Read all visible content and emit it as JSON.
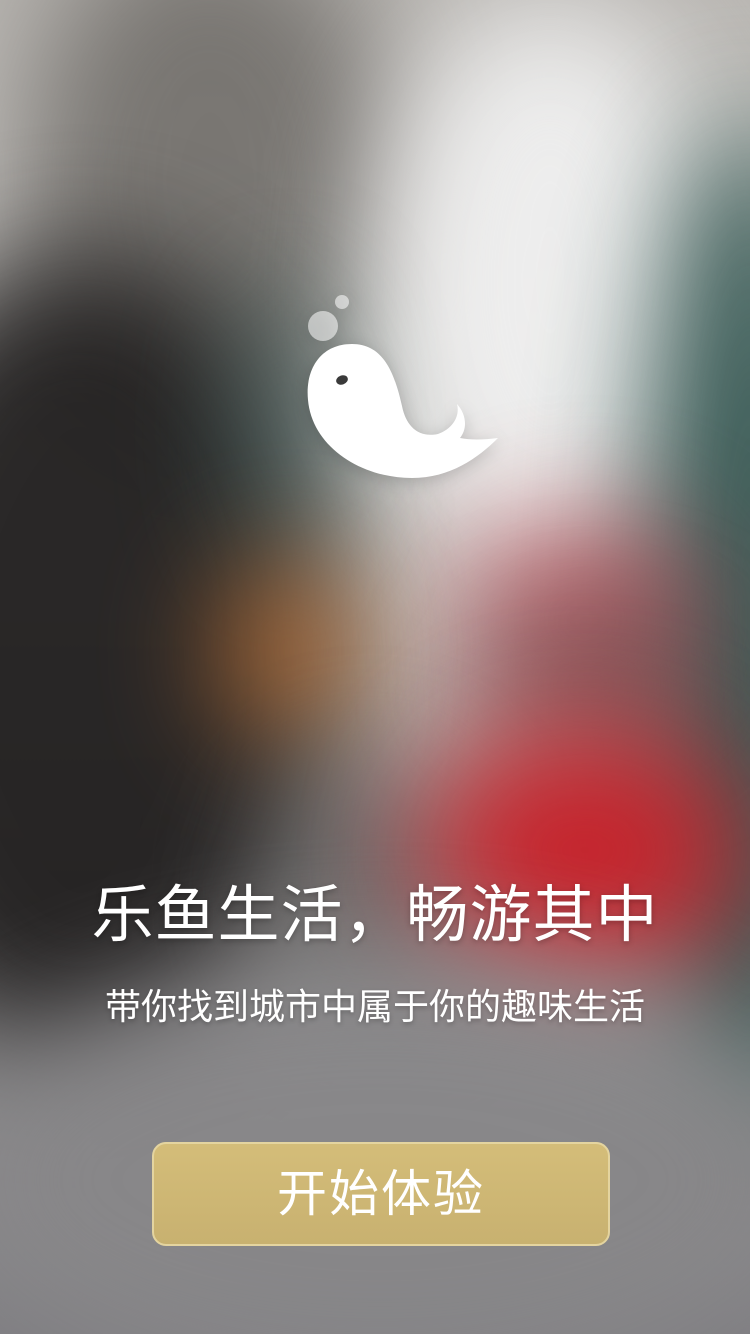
{
  "splash": {
    "logo_icon": "whale-icon",
    "headline": "乐鱼生活，畅游其中",
    "subtitle": "带你找到城市中属于你的趣味生活",
    "start_button_label": "开始体验"
  },
  "colors": {
    "button_fill": "#cdb673",
    "button_border": "#e4d49f",
    "text": "#ffffff"
  }
}
